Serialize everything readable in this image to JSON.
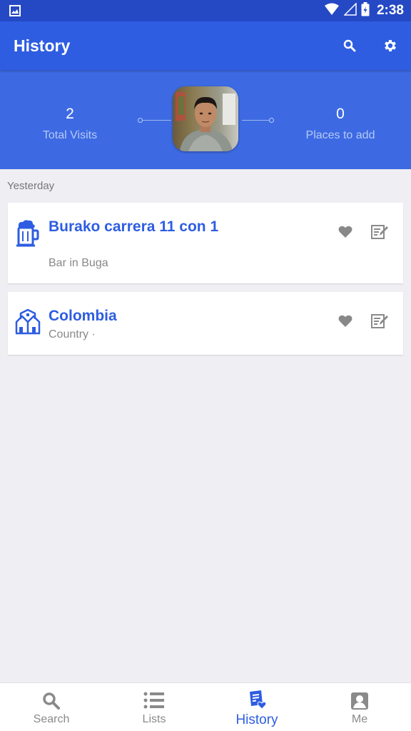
{
  "status_bar": {
    "time": "2:38"
  },
  "app_bar": {
    "title": "History",
    "search_icon": "search-icon",
    "settings_icon": "gear-icon"
  },
  "stats": {
    "total_visits": {
      "value": "2",
      "label": "Total Visits"
    },
    "places_to_add": {
      "value": "0",
      "label": "Places to add"
    }
  },
  "section_label": "Yesterday",
  "places": [
    {
      "name": "Burako carrera 11 con 1",
      "subtitle": "Bar in Buga",
      "icon": "beer-mug-icon"
    },
    {
      "name": "Colombia",
      "subtitle": "Country ·",
      "icon": "town-icon"
    }
  ],
  "bottom_nav": [
    {
      "label": "Search",
      "icon": "search-icon",
      "active": false
    },
    {
      "label": "Lists",
      "icon": "list-icon",
      "active": false
    },
    {
      "label": "History",
      "icon": "history-icon",
      "active": true
    },
    {
      "label": "Me",
      "icon": "profile-icon",
      "active": false
    }
  ],
  "colors": {
    "status_bar": "#2549c5",
    "app_bar": "#2e5de2",
    "banner": "#3d6ae3",
    "accent": "#2e5de2",
    "background": "#eeeef3"
  }
}
